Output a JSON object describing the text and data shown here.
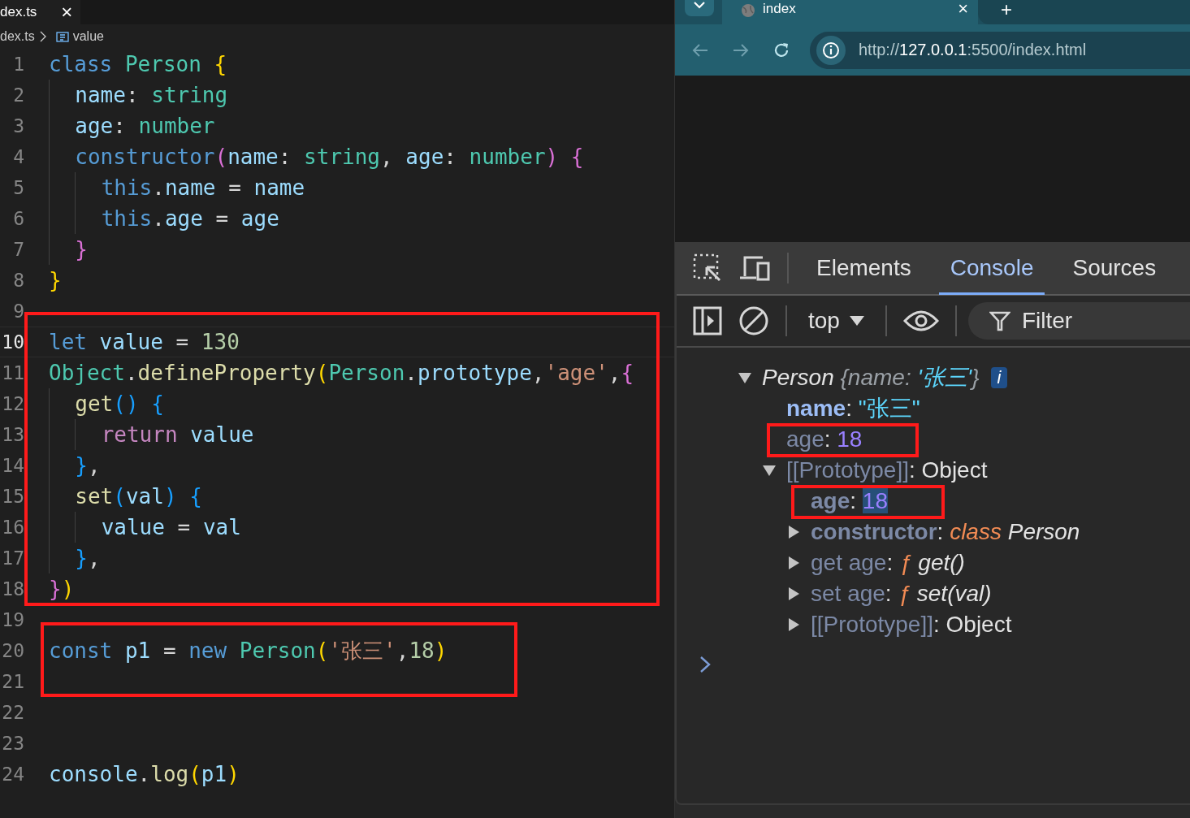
{
  "editor": {
    "tab": {
      "title": "dex.ts",
      "close": "×"
    },
    "breadcrumb": [
      {
        "kind": "file",
        "text": "dex.ts"
      },
      {
        "kind": "symbol",
        "text": "value"
      }
    ],
    "blocks": [
      {
        "boxed": false,
        "lines": [
          {
            "number": "1",
            "current": false,
            "tokens": [
              {
                "kind": "keyword",
                "text": "class"
              },
              {
                "kind": "type",
                "text": " Person"
              },
              {
                "kind": "brace1",
                "text": " {"
              }
            ]
          },
          {
            "number": "2",
            "current": false,
            "tokens": [
              {
                "kind": "prop",
                "text": "  name"
              },
              {
                "kind": "plain",
                "text": ": "
              },
              {
                "kind": "type",
                "text": "string"
              }
            ]
          },
          {
            "number": "3",
            "current": false,
            "tokens": [
              {
                "kind": "prop",
                "text": "  age"
              },
              {
                "kind": "plain",
                "text": ": "
              },
              {
                "kind": "type",
                "text": "number"
              }
            ]
          },
          {
            "number": "4",
            "current": false,
            "tokens": [
              {
                "kind": "keyword",
                "text": "  constructor"
              },
              {
                "kind": "brace2",
                "text": "("
              },
              {
                "kind": "prop",
                "text": "name"
              },
              {
                "kind": "plain",
                "text": ": "
              },
              {
                "kind": "type",
                "text": "string"
              },
              {
                "kind": "plain",
                "text": ", "
              },
              {
                "kind": "prop",
                "text": "age"
              },
              {
                "kind": "plain",
                "text": ": "
              },
              {
                "kind": "type",
                "text": "number"
              },
              {
                "kind": "brace2",
                "text": ") {"
              }
            ]
          },
          {
            "number": "5",
            "current": false,
            "tokens": [
              {
                "kind": "keyword",
                "text": "    this"
              },
              {
                "kind": "plain",
                "text": "."
              },
              {
                "kind": "prop",
                "text": "name"
              },
              {
                "kind": "plain",
                "text": " = "
              },
              {
                "kind": "prop",
                "text": "name"
              }
            ]
          },
          {
            "number": "6",
            "current": false,
            "tokens": [
              {
                "kind": "keyword",
                "text": "    this"
              },
              {
                "kind": "plain",
                "text": "."
              },
              {
                "kind": "prop",
                "text": "age"
              },
              {
                "kind": "plain",
                "text": " = "
              },
              {
                "kind": "prop",
                "text": "age"
              }
            ]
          },
          {
            "number": "7",
            "current": false,
            "tokens": [
              {
                "kind": "brace2",
                "text": "  }"
              }
            ]
          },
          {
            "number": "8",
            "current": false,
            "tokens": [
              {
                "kind": "brace1",
                "text": "}"
              }
            ]
          },
          {
            "number": "9",
            "current": false
          }
        ]
      },
      {
        "boxed": true,
        "lines": [
          {
            "number": "10",
            "current": true,
            "tokens": [
              {
                "kind": "keyword",
                "text": "let"
              },
              {
                "kind": "prop",
                "text": " value"
              },
              {
                "kind": "plain",
                "text": " = "
              },
              {
                "kind": "number",
                "text": "130"
              }
            ]
          },
          {
            "number": "11",
            "current": false,
            "tokens": [
              {
                "kind": "type",
                "text": "Object"
              },
              {
                "kind": "plain",
                "text": "."
              },
              {
                "kind": "func",
                "text": "defineProperty"
              },
              {
                "kind": "brace1",
                "text": "("
              },
              {
                "kind": "type",
                "text": "Person"
              },
              {
                "kind": "plain",
                "text": "."
              },
              {
                "kind": "prop",
                "text": "prototype"
              },
              {
                "kind": "plain",
                "text": ","
              },
              {
                "kind": "string",
                "text": "'age'"
              },
              {
                "kind": "plain",
                "text": ","
              },
              {
                "kind": "brace2",
                "text": "{"
              }
            ]
          },
          {
            "number": "12",
            "current": false,
            "tokens": [
              {
                "kind": "func",
                "text": "  get"
              },
              {
                "kind": "brace3",
                "text": "() {"
              }
            ]
          },
          {
            "number": "13",
            "current": false,
            "tokens": [
              {
                "kind": "control",
                "text": "    return"
              },
              {
                "kind": "prop",
                "text": " value"
              }
            ]
          },
          {
            "number": "14",
            "current": false,
            "tokens": [
              {
                "kind": "brace3",
                "text": "  }"
              },
              {
                "kind": "plain",
                "text": ","
              }
            ]
          },
          {
            "number": "15",
            "current": false,
            "tokens": [
              {
                "kind": "func",
                "text": "  set"
              },
              {
                "kind": "brace3",
                "text": "("
              },
              {
                "kind": "prop",
                "text": "val"
              },
              {
                "kind": "brace3",
                "text": ") {"
              }
            ]
          },
          {
            "number": "16",
            "current": false,
            "tokens": [
              {
                "kind": "prop",
                "text": "    value"
              },
              {
                "kind": "plain",
                "text": " = "
              },
              {
                "kind": "prop",
                "text": "val"
              }
            ]
          },
          {
            "number": "17",
            "current": false,
            "tokens": [
              {
                "kind": "brace3",
                "text": "  }"
              },
              {
                "kind": "plain",
                "text": ","
              }
            ]
          },
          {
            "number": "18",
            "current": false,
            "tokens": [
              {
                "kind": "brace2",
                "text": "}"
              },
              {
                "kind": "brace1",
                "text": ")"
              }
            ]
          }
        ]
      },
      {
        "boxed": false,
        "lines": [
          {
            "number": "19",
            "current": false
          }
        ]
      },
      {
        "boxed": true,
        "lines": [
          {
            "number": "20",
            "current": false,
            "tokens": [
              {
                "kind": "keyword",
                "text": "const"
              },
              {
                "kind": "prop",
                "text": " p1"
              },
              {
                "kind": "plain",
                "text": " = "
              },
              {
                "kind": "keyword",
                "text": "new"
              },
              {
                "kind": "type",
                "text": " Person"
              },
              {
                "kind": "brace1",
                "text": "("
              },
              {
                "kind": "string",
                "text": "'张三'"
              },
              {
                "kind": "plain",
                "text": ","
              },
              {
                "kind": "number",
                "text": "18"
              },
              {
                "kind": "brace1",
                "text": ")"
              }
            ]
          },
          {
            "number": "21",
            "current": false
          }
        ]
      },
      {
        "boxed": false,
        "lines": [
          {
            "number": "22",
            "current": false
          },
          {
            "number": "23",
            "current": false
          },
          {
            "number": "24",
            "current": false,
            "tokens": [
              {
                "kind": "prop",
                "text": "console"
              },
              {
                "kind": "plain",
                "text": "."
              },
              {
                "kind": "func",
                "text": "log"
              },
              {
                "kind": "brace1",
                "text": "("
              },
              {
                "kind": "prop",
                "text": "p1"
              },
              {
                "kind": "brace1",
                "text": ")"
              }
            ]
          }
        ]
      }
    ]
  },
  "browser": {
    "tab": {
      "title": "index",
      "close": "×"
    },
    "new_tab": "+",
    "url": {
      "scheme": "http://",
      "host": "127.0.0.1",
      "rest": ":5500/index.html"
    }
  },
  "devtools": {
    "tabs": [
      {
        "label": "Elements",
        "selected": false
      },
      {
        "label": "Console",
        "selected": true
      },
      {
        "label": "Sources",
        "selected": false
      }
    ],
    "context": "top",
    "filter": {
      "placeholder": "Filter"
    },
    "console": [
      {
        "kind": "object",
        "expanded": true,
        "boxed": false,
        "badge": "i",
        "segments": [
          {
            "kind": "italic",
            "text": "Person "
          },
          {
            "kind": "preview",
            "text": "{name: "
          },
          {
            "kind": "preview-string",
            "text": "'张三'"
          },
          {
            "kind": "preview",
            "text": "}"
          }
        ],
        "children": [
          {
            "kind": "property",
            "boxed": false,
            "segments": [
              {
                "kind": "key",
                "text": "name"
              },
              {
                "kind": "punct",
                "text": ": "
              },
              {
                "kind": "string",
                "text": "\"张三\""
              }
            ]
          },
          {
            "kind": "property",
            "boxed": true,
            "segments": [
              {
                "kind": "dim-key",
                "text": "age"
              },
              {
                "kind": "punct",
                "text": ": "
              },
              {
                "kind": "number",
                "text": "18"
              }
            ]
          },
          {
            "kind": "object",
            "expanded": true,
            "boxed": false,
            "segments": [
              {
                "kind": "dim-key",
                "text": "[[Prototype]]"
              },
              {
                "kind": "punct",
                "text": ": "
              },
              {
                "kind": "plain",
                "text": "Object"
              }
            ],
            "children": [
              {
                "kind": "property",
                "boxed": true,
                "segments": [
                  {
                    "kind": "bold-dim-key",
                    "text": "age"
                  },
                  {
                    "kind": "punct",
                    "text": ": "
                  },
                  {
                    "kind": "number-selected",
                    "text": "18"
                  }
                ]
              },
              {
                "kind": "object",
                "expanded": false,
                "boxed": false,
                "segments": [
                  {
                    "kind": "bold-dim-key",
                    "text": "constructor"
                  },
                  {
                    "kind": "punct",
                    "text": ": "
                  },
                  {
                    "kind": "keyword",
                    "text": "class "
                  },
                  {
                    "kind": "italic",
                    "text": "Person"
                  }
                ]
              },
              {
                "kind": "object",
                "expanded": false,
                "boxed": false,
                "segments": [
                  {
                    "kind": "dim-key",
                    "text": "get age"
                  },
                  {
                    "kind": "punct",
                    "text": ": "
                  },
                  {
                    "kind": "keyword",
                    "text": "ƒ "
                  },
                  {
                    "kind": "italic",
                    "text": "get()"
                  }
                ]
              },
              {
                "kind": "object",
                "expanded": false,
                "boxed": false,
                "segments": [
                  {
                    "kind": "dim-key",
                    "text": "set age"
                  },
                  {
                    "kind": "punct",
                    "text": ": "
                  },
                  {
                    "kind": "keyword",
                    "text": "ƒ "
                  },
                  {
                    "kind": "italic",
                    "text": "set(val)"
                  }
                ]
              },
              {
                "kind": "object",
                "expanded": false,
                "boxed": false,
                "segments": [
                  {
                    "kind": "dim-key",
                    "text": "[[Prototype]]"
                  },
                  {
                    "kind": "punct",
                    "text": ": "
                  },
                  {
                    "kind": "plain",
                    "text": "Object"
                  }
                ]
              }
            ]
          }
        ]
      }
    ]
  }
}
